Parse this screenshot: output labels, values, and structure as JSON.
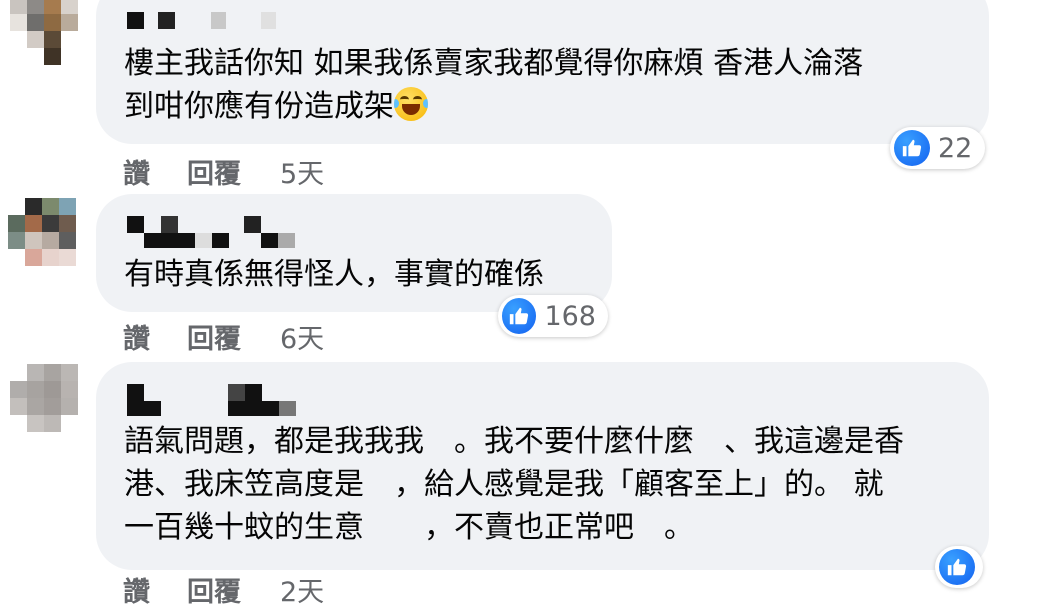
{
  "comments": [
    {
      "text_lines": [
        "樓主我話你知 如果我係賣家我都覺得你麻煩 香港人淪落",
        "到咁你應有份造成架"
      ],
      "emoji": "face-with-tears-of-joy",
      "likes": "22",
      "actions": {
        "like": "讚",
        "reply": "回覆",
        "time": "5天"
      }
    },
    {
      "text_lines": [
        "有時真係無得怪人，事實的確係"
      ],
      "likes": "168",
      "actions": {
        "like": "讚",
        "reply": "回覆",
        "time": "6天"
      }
    },
    {
      "text_lines": [
        "語氣問題，都是我我我　。我不要什麼什麼　、我這邊是香",
        "港、我床笠高度是　，給人感覺是我「顧客至上」的。 就",
        "一百幾十蚊的生意　　，不賣也正常吧　。"
      ],
      "likes": "",
      "actions": {
        "like": "讚",
        "reply": "回覆",
        "time": "2天"
      }
    }
  ],
  "colors": {
    "bubble": "#f0f2f5",
    "like_blue": "#1877f2",
    "meta_gray": "#65676b",
    "text": "#050505"
  },
  "icons": [
    "like-icon",
    "face-with-tears-of-joy-icon"
  ]
}
